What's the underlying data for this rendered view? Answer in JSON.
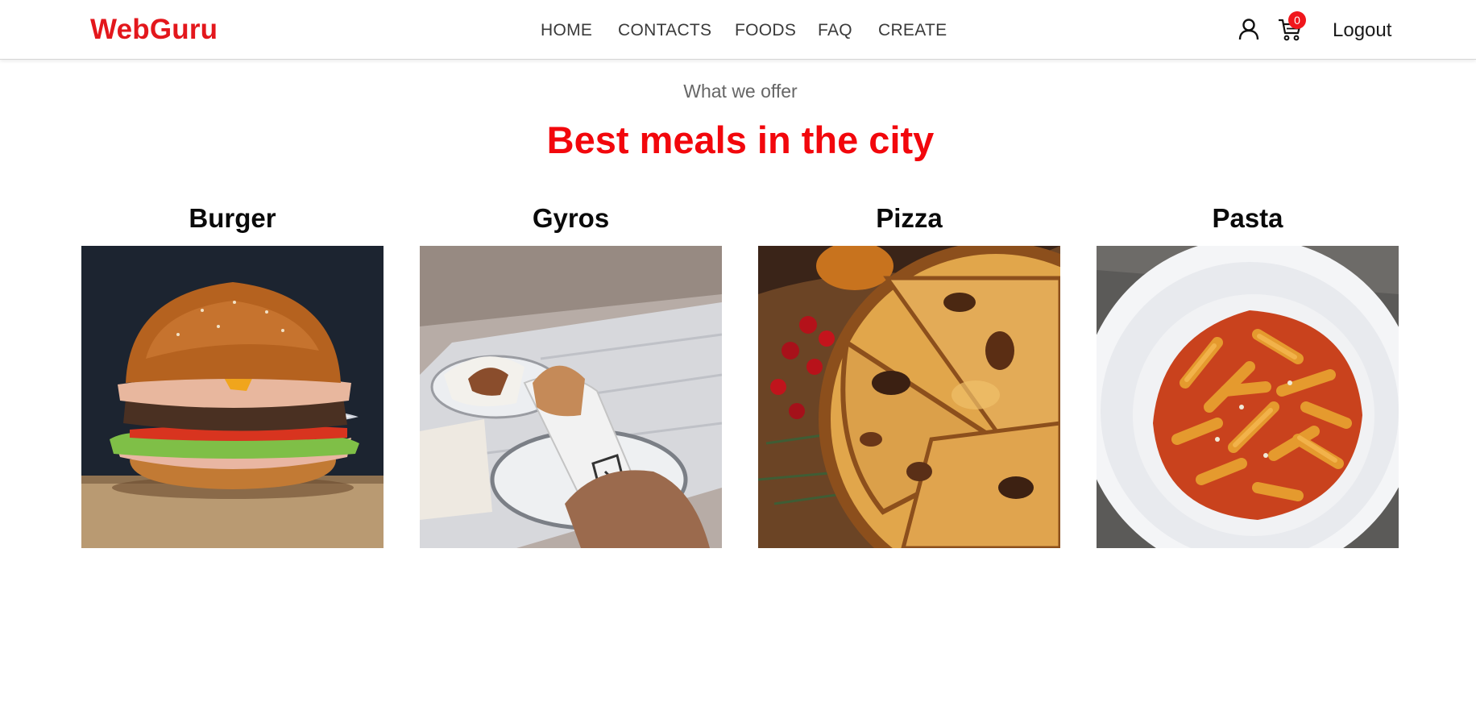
{
  "brand": {
    "name": "WebGuru",
    "color": "#e3171c"
  },
  "nav": {
    "links": [
      {
        "label": "HOME"
      },
      {
        "label": "CONTACTS"
      },
      {
        "label": "FOODS"
      },
      {
        "label": "FAQ"
      },
      {
        "label": "CREATE"
      }
    ],
    "user_icon": "user-icon",
    "cart_icon": "cart-icon",
    "cart_count": "0",
    "logout_label": "Logout"
  },
  "hero": {
    "subtitle": "What we offer",
    "title": "Best meals in the city",
    "title_color": "#f2070c"
  },
  "foods": [
    {
      "name": "Burger",
      "image": "burger-photo"
    },
    {
      "name": "Gyros",
      "image": "gyros-photo"
    },
    {
      "name": "Pizza",
      "image": "pizza-photo"
    },
    {
      "name": "Pasta",
      "image": "pasta-photo"
    }
  ]
}
